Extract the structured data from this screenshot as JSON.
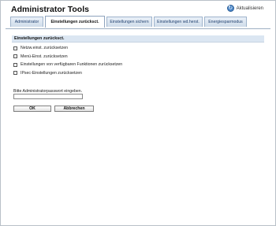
{
  "header": {
    "title": "Administrator Tools",
    "refresh_label": "Aktualisieren",
    "refresh_icon": "refresh-icon"
  },
  "tabs": [
    {
      "label": "Administrator",
      "active": false
    },
    {
      "label": "Einstellungen zurücksct.",
      "active": true
    },
    {
      "label": "Einstellungen sichern",
      "active": false
    },
    {
      "label": "Einstellungen wd.herst.",
      "active": false
    },
    {
      "label": "Energiesparmodus",
      "active": false
    }
  ],
  "section": {
    "title": "Einstellungen zurücksct.",
    "options": [
      {
        "label": "Netzw.einst. zurücksetzen",
        "checked": false
      },
      {
        "label": "Menü-Einst. zurücksetzen",
        "checked": false
      },
      {
        "label": "Einstellungen von verfügbaren Funktionen zurücksetzen",
        "checked": false
      },
      {
        "label": "IPsec-Einstellungen zurücksetzen",
        "checked": false
      }
    ]
  },
  "password": {
    "label": "Bitte Administratorpasswort eingeben.",
    "value": ""
  },
  "buttons": {
    "ok": "OK",
    "cancel": "Abbrechen"
  },
  "colors": {
    "accent": "#4a86c8",
    "section_bg": "#dbe6f2",
    "tab_bg": "#cfdcea"
  }
}
